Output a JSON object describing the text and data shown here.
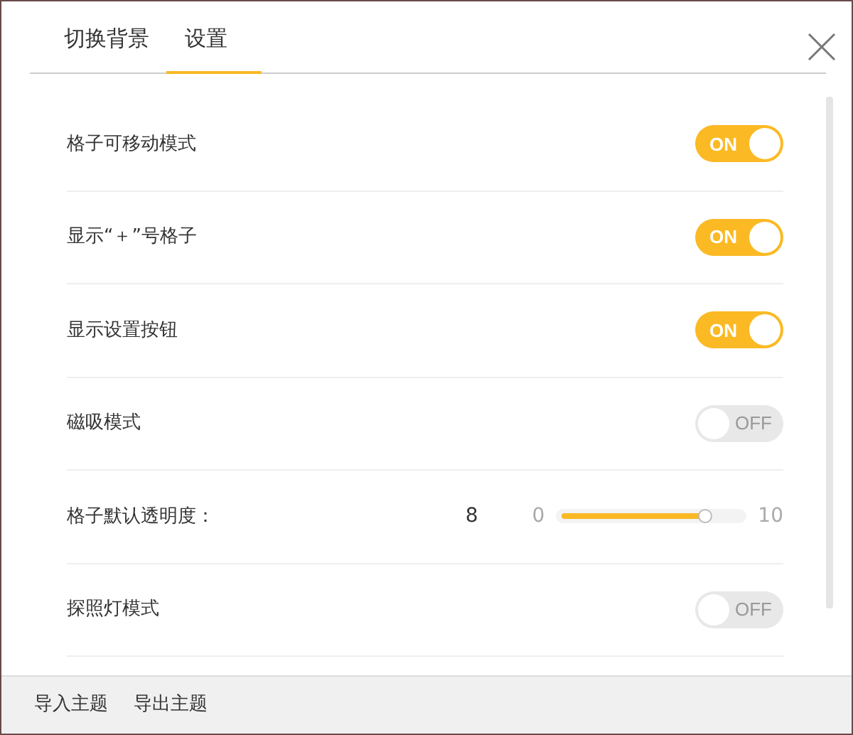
{
  "tabs": [
    {
      "label": "切换背景",
      "selected": false
    },
    {
      "label": "设置",
      "selected": true
    }
  ],
  "settings": [
    {
      "kind": "toggle",
      "label": "格子可移动模式",
      "on": true,
      "text": "ON"
    },
    {
      "kind": "toggle",
      "label": "显示“＋”号格子",
      "on": true,
      "text": "ON"
    },
    {
      "kind": "toggle",
      "label": "显示设置按钮",
      "on": true,
      "text": "ON"
    },
    {
      "kind": "toggle",
      "label": "磁吸模式",
      "on": false,
      "text": "OFF"
    },
    {
      "kind": "slider",
      "label": "格子默认透明度：",
      "reading": "8",
      "min": "0",
      "max": "10",
      "level": 0.8
    },
    {
      "kind": "toggle",
      "label": "探照灯模式",
      "on": false,
      "text": "OFF"
    }
  ],
  "footer": {
    "buttons": [
      "导入主题",
      "导出主题"
    ]
  }
}
